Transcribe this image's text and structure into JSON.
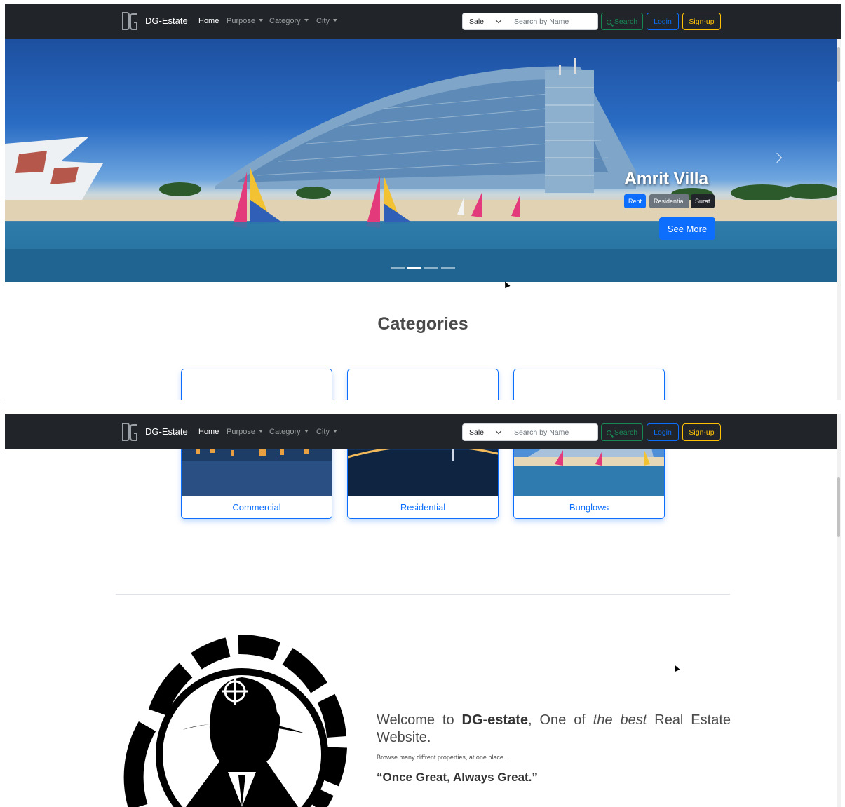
{
  "navbar": {
    "brand": "DG-Estate",
    "links": [
      "Home",
      "Purpose",
      "Category",
      "City"
    ],
    "purpose_select": "Sale",
    "search_placeholder": "Search by Name",
    "search_button": "Search",
    "login_button": "Login",
    "signup_button": "Sign-up"
  },
  "carousel": {
    "title": "Amrit Villa",
    "badges": {
      "purpose": "Rent",
      "category": "Residential",
      "city": "Surat"
    },
    "cta": "See More",
    "active_slide": 2,
    "slide_count": 4
  },
  "categories": {
    "heading": "Categories",
    "items": [
      "Commercial",
      "Residential",
      "Bunglows"
    ]
  },
  "welcome": {
    "prefix": "Welcome to ",
    "brand": "DG-estate",
    "middle": ", One of ",
    "emphasis": "the best",
    "suffix": " Real Estate Website.",
    "subtext": "Browse many diffrent properties, at one place...",
    "motto": "“Once Great, Always Great.”"
  },
  "colors": {
    "navbar": "#212529",
    "primary": "#0d6efd",
    "success": "#198754",
    "warning": "#ffc107",
    "secondary": "#6c757d"
  },
  "icons": [
    "brand-logo-icon",
    "caret-down-icon",
    "chevron-down-icon",
    "search-icon",
    "chevron-right-icon",
    "mouse-cursor-icon"
  ]
}
